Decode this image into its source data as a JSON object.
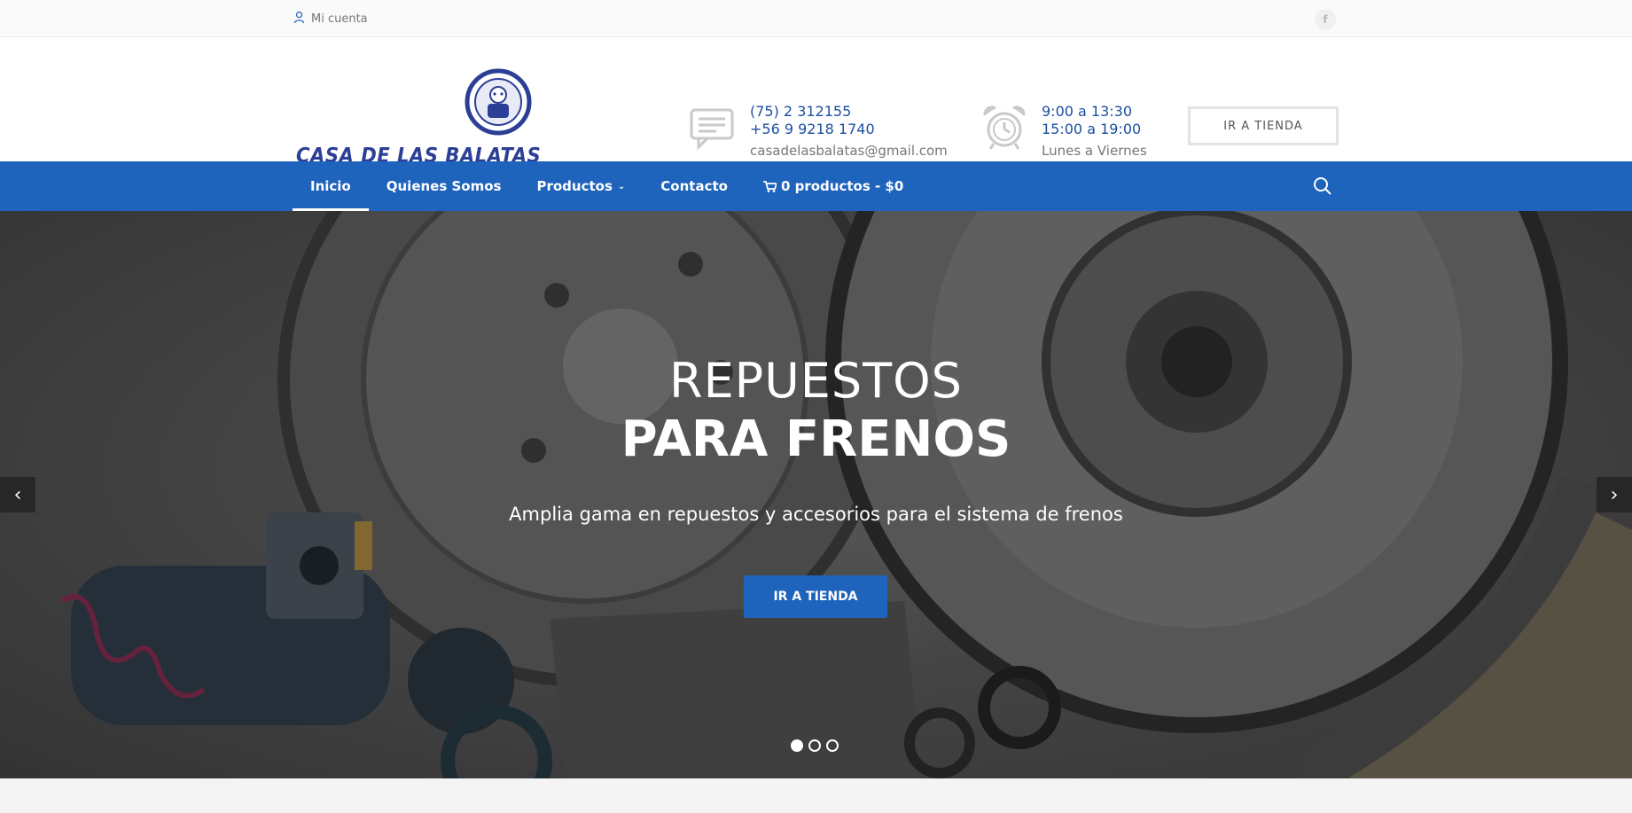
{
  "topbar": {
    "account_label": "Mi cuenta",
    "facebook_icon": "f"
  },
  "header": {
    "logo_text": "CASA DE LAS BALATAS",
    "phone1": "(75) 2 312155",
    "phone2": "+56 9 9218 1740",
    "email": "casadelasbalatas@gmail.com",
    "hours1": "9:00 a 13:30",
    "hours2": "15:00 a 19:00",
    "days": "Lunes a Viernes",
    "store_button": "IR A TIENDA"
  },
  "nav": {
    "items": [
      {
        "label": "Inicio"
      },
      {
        "label": "Quienes Somos"
      },
      {
        "label": "Productos"
      },
      {
        "label": "Contacto"
      },
      {
        "label": "0 productos - $0"
      }
    ]
  },
  "hero": {
    "title_line1": "REPUESTOS",
    "title_line2": "PARA FRENOS",
    "subtitle": "Amplia gama en repuestos y accesorios para el sistema de frenos",
    "button": "IR A TIENDA",
    "active_slide": 1,
    "slide_count": 3
  },
  "colors": {
    "accent": "#1e63bc",
    "link_blue": "#1c4fa0",
    "logo_blue": "#2c3f96"
  },
  "icons": [
    "user-icon",
    "facebook-icon",
    "chat-icon",
    "alarm-clock-icon",
    "cart-icon",
    "chevron-down-icon",
    "search-icon",
    "arrow-left-icon",
    "arrow-right-icon"
  ]
}
